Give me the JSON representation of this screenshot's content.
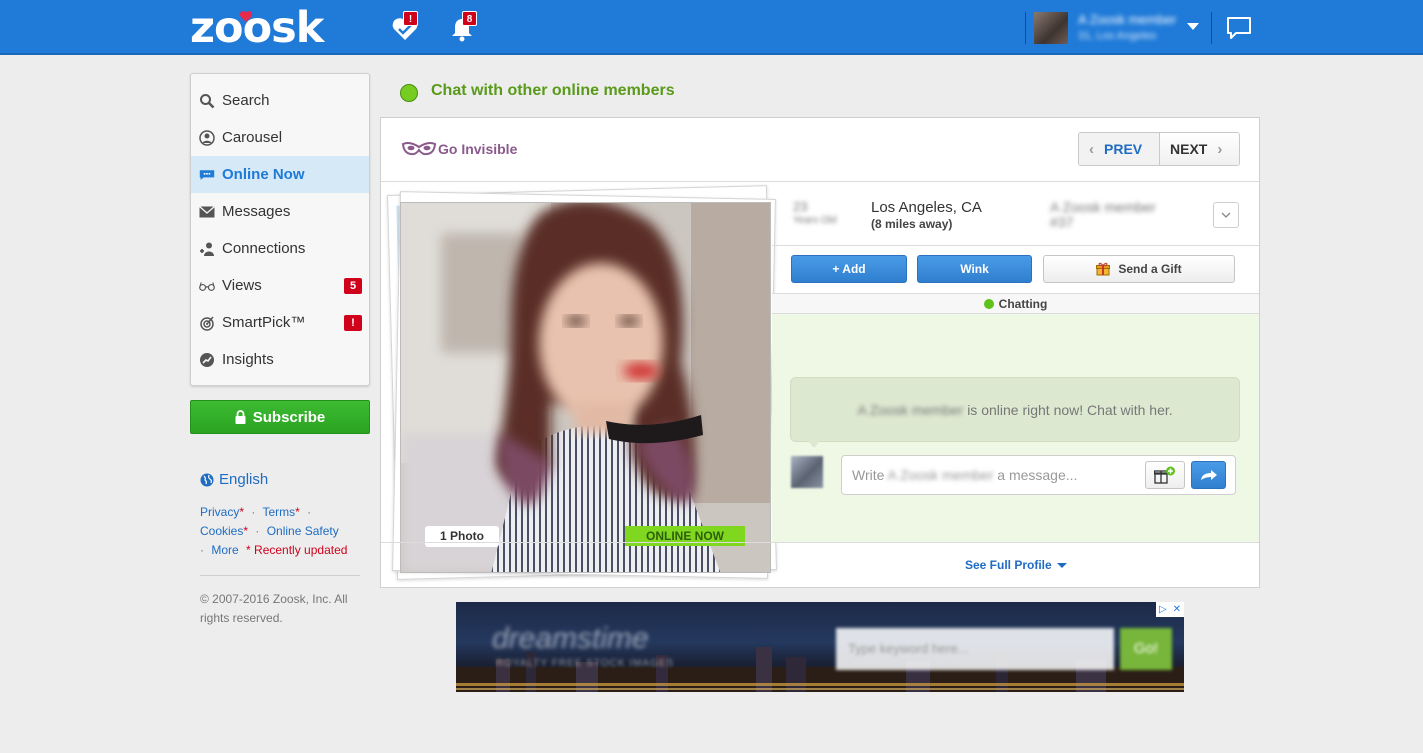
{
  "header": {
    "logo": "zoosk",
    "smartpick_badge": "!",
    "notifications_badge": "8",
    "user_name": "A Zoosk member",
    "user_sub": "31, Los Angeles"
  },
  "sidebar": {
    "items": [
      {
        "label": "Search",
        "icon": "search-icon"
      },
      {
        "label": "Carousel",
        "icon": "carousel-icon"
      },
      {
        "label": "Online Now",
        "icon": "chat-bubble-icon",
        "active": true
      },
      {
        "label": "Messages",
        "icon": "envelope-icon"
      },
      {
        "label": "Connections",
        "icon": "connections-icon"
      },
      {
        "label": "Views",
        "icon": "glasses-icon",
        "badge": "5"
      },
      {
        "label": "SmartPick™",
        "icon": "target-icon",
        "badge": "!"
      },
      {
        "label": "Insights",
        "icon": "insights-icon"
      }
    ],
    "subscribe_label": "Subscribe",
    "language": "English",
    "links": {
      "privacy": "Privacy",
      "terms": "Terms",
      "cookies": "Cookies",
      "online_safety": "Online Safety",
      "more": "More",
      "recently_updated": "* Recently updated",
      "star": "*",
      "dot": "·"
    },
    "copyright": "© 2007-2016 Zoosk, Inc. All rights reserved."
  },
  "main": {
    "heading": "Chat with other online members",
    "go_invisible": "Go Invisible",
    "prev": "PREV",
    "next": "NEXT",
    "photo_count": "1 Photo",
    "online_badge": "ONLINE NOW",
    "age": "23",
    "age_sub": "Years Old",
    "location": "Los Angeles, CA",
    "distance": "(8 miles away)",
    "member_name": "A Zoosk member",
    "member_sub": "#37",
    "add_label": "+ Add",
    "wink_label": "Wink",
    "gift_label": "Send a Gift",
    "chatting_label": "Chatting",
    "bubble_name": "A Zoosk member",
    "bubble_text": "is online right now! Chat with her.",
    "message_placeholder_prefix": "Write",
    "message_placeholder_name": "A Zoosk member",
    "message_placeholder_suffix": "a message...",
    "see_full_profile": "See Full Profile"
  },
  "ad": {
    "brand": "dreamstime",
    "tagline": "ROYALTY FREE STOCK IMAGES",
    "input_placeholder": "Type keyword here...",
    "go_label": "Go!"
  },
  "colors": {
    "header_blue": "#1f7ad8",
    "online_green": "#76cc21",
    "badge_red": "#d0021b",
    "subscribe_green": "#2aa321"
  }
}
